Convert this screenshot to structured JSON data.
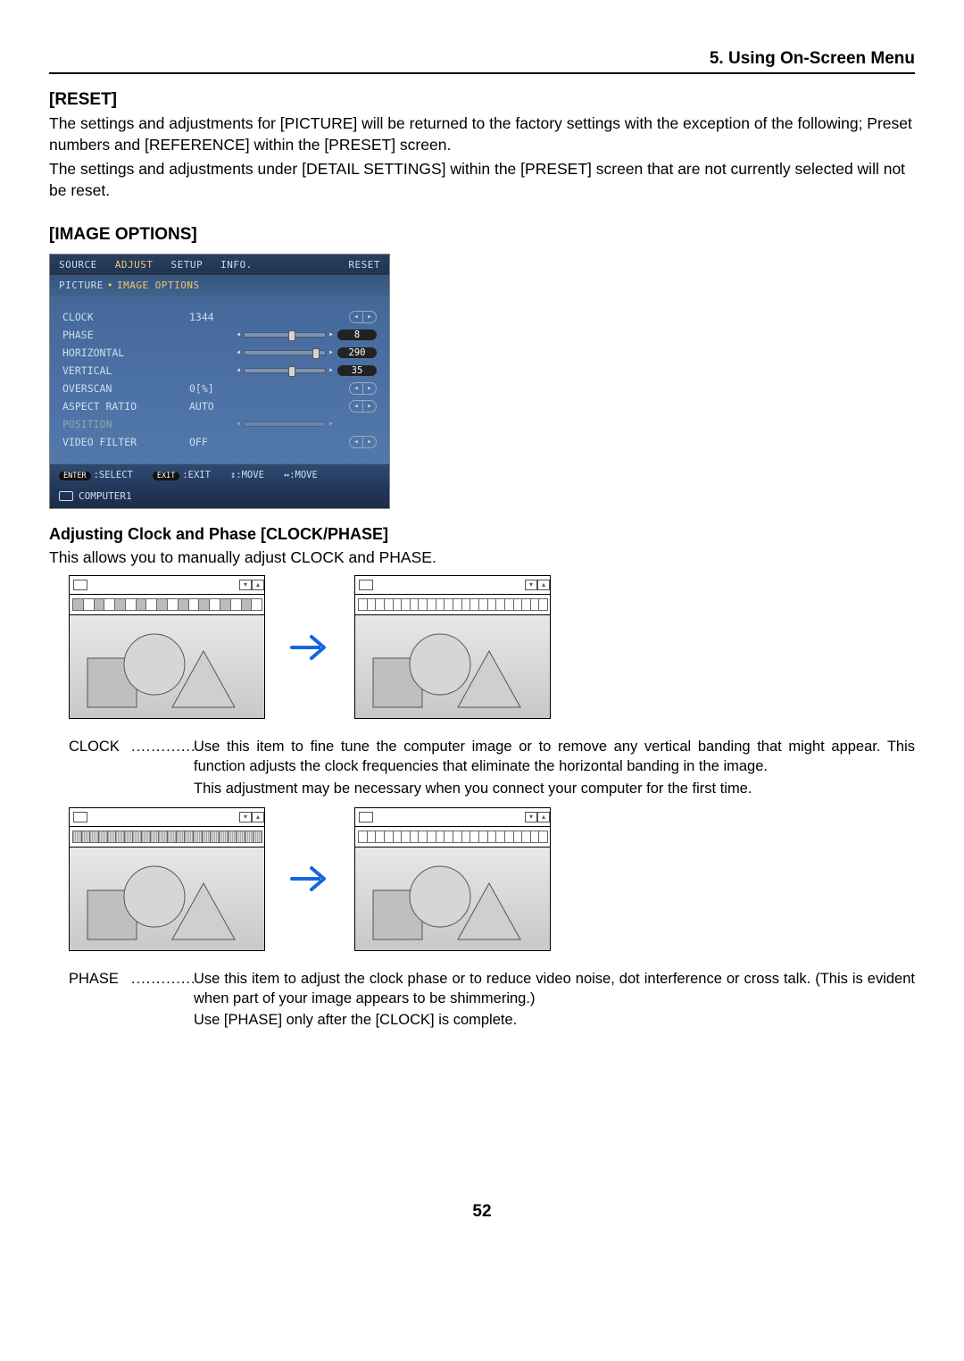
{
  "header": {
    "chapter": "5. Using On-Screen Menu"
  },
  "reset": {
    "title": "[RESET]",
    "p1": "The settings and adjustments for [PICTURE] will be returned to the factory settings with the exception of the following; Preset numbers and [REFERENCE] within the [PRESET] screen.",
    "p2": "The settings and adjustments under [DETAIL SETTINGS] within the [PRESET] screen that are not currently selected will not be reset."
  },
  "image_options": {
    "title": "[IMAGE OPTIONS]",
    "osd": {
      "tabs": {
        "source": "SOURCE",
        "adjust": "ADJUST",
        "setup": "SETUP",
        "info": "INFO.",
        "reset": "RESET",
        "active": "ADJUST"
      },
      "breadcrumb": {
        "a": "PICTURE",
        "b": "IMAGE OPTIONS"
      },
      "rows": {
        "clock": {
          "label": "CLOCK",
          "value": "1344",
          "ctrl": "spinner"
        },
        "phase": {
          "label": "PHASE",
          "pill": "8",
          "ctrl": "slider",
          "pos": 55
        },
        "horizontal": {
          "label": "HORIZONTAL",
          "pill": "290",
          "ctrl": "slider",
          "pos": 88
        },
        "vertical": {
          "label": "VERTICAL",
          "pill": "35",
          "ctrl": "slider",
          "pos": 55
        },
        "overscan": {
          "label": "OVERSCAN",
          "value": "0[%]",
          "ctrl": "spinner"
        },
        "aspect_ratio": {
          "label": "ASPECT RATIO",
          "value": "AUTO",
          "ctrl": "spinner"
        },
        "position": {
          "label": "POSITION",
          "value": "",
          "ctrl": "slider_disabled",
          "disabled": true
        },
        "video_filter": {
          "label": "VIDEO FILTER",
          "value": "OFF",
          "ctrl": "spinner"
        }
      },
      "footer": {
        "enter": "ENTER",
        "select": ":SELECT",
        "exit": "EXIT",
        "exit_label": ":EXIT",
        "move_v": ":MOVE",
        "move_h": ":MOVE",
        "source": "COMPUTER1"
      }
    }
  },
  "clockphase": {
    "title": "Adjusting Clock and Phase [CLOCK/PHASE]",
    "intro": "This allows you to manually adjust CLOCK and PHASE.",
    "clock": {
      "term": "CLOCK",
      "l1": "Use this item to fine tune the computer image or to remove any vertical banding that might appear. This function adjusts the clock frequencies that eliminate the horizontal banding in the image.",
      "l2": "This adjustment may be necessary when you connect your computer for the first time."
    },
    "phase": {
      "term": "PHASE",
      "l1": "Use this item to adjust the clock phase or to reduce video noise, dot interference or cross talk. (This is evident when part of your image appears to be shimmering.)",
      "l2": "Use [PHASE] only after the [CLOCK] is complete."
    }
  },
  "page_number": "52"
}
